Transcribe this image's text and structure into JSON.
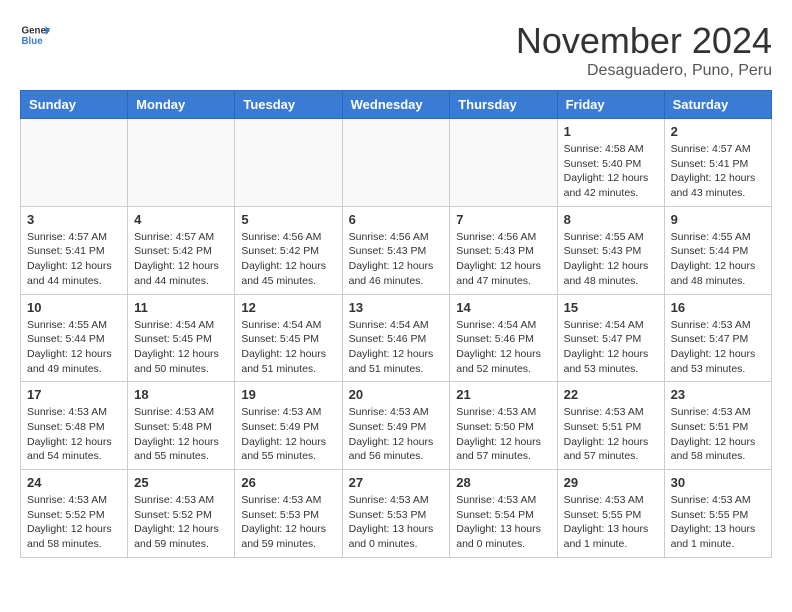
{
  "logo": {
    "general": "General",
    "blue": "Blue"
  },
  "title": "November 2024",
  "location": "Desaguadero, Puno, Peru",
  "days_of_week": [
    "Sunday",
    "Monday",
    "Tuesday",
    "Wednesday",
    "Thursday",
    "Friday",
    "Saturday"
  ],
  "weeks": [
    [
      {
        "day": "",
        "info": ""
      },
      {
        "day": "",
        "info": ""
      },
      {
        "day": "",
        "info": ""
      },
      {
        "day": "",
        "info": ""
      },
      {
        "day": "",
        "info": ""
      },
      {
        "day": "1",
        "info": "Sunrise: 4:58 AM\nSunset: 5:40 PM\nDaylight: 12 hours\nand 42 minutes."
      },
      {
        "day": "2",
        "info": "Sunrise: 4:57 AM\nSunset: 5:41 PM\nDaylight: 12 hours\nand 43 minutes."
      }
    ],
    [
      {
        "day": "3",
        "info": "Sunrise: 4:57 AM\nSunset: 5:41 PM\nDaylight: 12 hours\nand 44 minutes."
      },
      {
        "day": "4",
        "info": "Sunrise: 4:57 AM\nSunset: 5:42 PM\nDaylight: 12 hours\nand 44 minutes."
      },
      {
        "day": "5",
        "info": "Sunrise: 4:56 AM\nSunset: 5:42 PM\nDaylight: 12 hours\nand 45 minutes."
      },
      {
        "day": "6",
        "info": "Sunrise: 4:56 AM\nSunset: 5:43 PM\nDaylight: 12 hours\nand 46 minutes."
      },
      {
        "day": "7",
        "info": "Sunrise: 4:56 AM\nSunset: 5:43 PM\nDaylight: 12 hours\nand 47 minutes."
      },
      {
        "day": "8",
        "info": "Sunrise: 4:55 AM\nSunset: 5:43 PM\nDaylight: 12 hours\nand 48 minutes."
      },
      {
        "day": "9",
        "info": "Sunrise: 4:55 AM\nSunset: 5:44 PM\nDaylight: 12 hours\nand 48 minutes."
      }
    ],
    [
      {
        "day": "10",
        "info": "Sunrise: 4:55 AM\nSunset: 5:44 PM\nDaylight: 12 hours\nand 49 minutes."
      },
      {
        "day": "11",
        "info": "Sunrise: 4:54 AM\nSunset: 5:45 PM\nDaylight: 12 hours\nand 50 minutes."
      },
      {
        "day": "12",
        "info": "Sunrise: 4:54 AM\nSunset: 5:45 PM\nDaylight: 12 hours\nand 51 minutes."
      },
      {
        "day": "13",
        "info": "Sunrise: 4:54 AM\nSunset: 5:46 PM\nDaylight: 12 hours\nand 51 minutes."
      },
      {
        "day": "14",
        "info": "Sunrise: 4:54 AM\nSunset: 5:46 PM\nDaylight: 12 hours\nand 52 minutes."
      },
      {
        "day": "15",
        "info": "Sunrise: 4:54 AM\nSunset: 5:47 PM\nDaylight: 12 hours\nand 53 minutes."
      },
      {
        "day": "16",
        "info": "Sunrise: 4:53 AM\nSunset: 5:47 PM\nDaylight: 12 hours\nand 53 minutes."
      }
    ],
    [
      {
        "day": "17",
        "info": "Sunrise: 4:53 AM\nSunset: 5:48 PM\nDaylight: 12 hours\nand 54 minutes."
      },
      {
        "day": "18",
        "info": "Sunrise: 4:53 AM\nSunset: 5:48 PM\nDaylight: 12 hours\nand 55 minutes."
      },
      {
        "day": "19",
        "info": "Sunrise: 4:53 AM\nSunset: 5:49 PM\nDaylight: 12 hours\nand 55 minutes."
      },
      {
        "day": "20",
        "info": "Sunrise: 4:53 AM\nSunset: 5:49 PM\nDaylight: 12 hours\nand 56 minutes."
      },
      {
        "day": "21",
        "info": "Sunrise: 4:53 AM\nSunset: 5:50 PM\nDaylight: 12 hours\nand 57 minutes."
      },
      {
        "day": "22",
        "info": "Sunrise: 4:53 AM\nSunset: 5:51 PM\nDaylight: 12 hours\nand 57 minutes."
      },
      {
        "day": "23",
        "info": "Sunrise: 4:53 AM\nSunset: 5:51 PM\nDaylight: 12 hours\nand 58 minutes."
      }
    ],
    [
      {
        "day": "24",
        "info": "Sunrise: 4:53 AM\nSunset: 5:52 PM\nDaylight: 12 hours\nand 58 minutes."
      },
      {
        "day": "25",
        "info": "Sunrise: 4:53 AM\nSunset: 5:52 PM\nDaylight: 12 hours\nand 59 minutes."
      },
      {
        "day": "26",
        "info": "Sunrise: 4:53 AM\nSunset: 5:53 PM\nDaylight: 12 hours\nand 59 minutes."
      },
      {
        "day": "27",
        "info": "Sunrise: 4:53 AM\nSunset: 5:53 PM\nDaylight: 13 hours\nand 0 minutes."
      },
      {
        "day": "28",
        "info": "Sunrise: 4:53 AM\nSunset: 5:54 PM\nDaylight: 13 hours\nand 0 minutes."
      },
      {
        "day": "29",
        "info": "Sunrise: 4:53 AM\nSunset: 5:55 PM\nDaylight: 13 hours\nand 1 minute."
      },
      {
        "day": "30",
        "info": "Sunrise: 4:53 AM\nSunset: 5:55 PM\nDaylight: 13 hours\nand 1 minute."
      }
    ]
  ]
}
